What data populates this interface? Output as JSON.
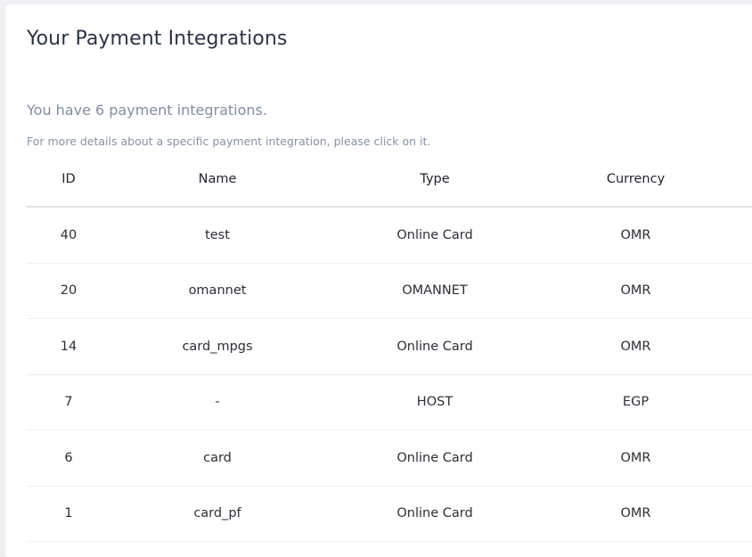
{
  "page": {
    "title": "Your Payment Integrations",
    "count_text": "You have 6 payment integrations.",
    "hint_text": "For more details about a specific payment integration, please click on it."
  },
  "table": {
    "headers": {
      "id": "ID",
      "name": "Name",
      "type": "Type",
      "currency": "Currency"
    },
    "rows": [
      {
        "id": "40",
        "name": "test",
        "type": "Online Card",
        "currency": "OMR"
      },
      {
        "id": "20",
        "name": "omannet",
        "type": "OMANNET",
        "currency": "OMR"
      },
      {
        "id": "14",
        "name": "card_mpgs",
        "type": "Online Card",
        "currency": "OMR"
      },
      {
        "id": "7",
        "name": "-",
        "type": "HOST",
        "currency": "EGP"
      },
      {
        "id": "6",
        "name": "card",
        "type": "Online Card",
        "currency": "OMR"
      },
      {
        "id": "1",
        "name": "card_pf",
        "type": "Online Card",
        "currency": "OMR"
      }
    ]
  }
}
